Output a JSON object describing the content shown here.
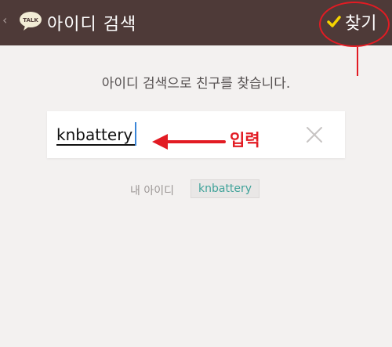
{
  "header": {
    "back_glyph": "‹",
    "logo_text": "TALK",
    "title": "아이디 검색",
    "find_label": "찾기"
  },
  "main": {
    "instruction": "아이디 검색으로 친구를 찾습니다.",
    "search_value": "knbattery",
    "annotation": "입력",
    "my_id_label": "내 아이디",
    "my_id_value": "knbattery"
  },
  "colors": {
    "topbar": "#4e3a38",
    "background": "#f3f1f0",
    "check_accent": "#f5d400",
    "annotation_red": "#e21b23",
    "my_id_text": "#41a39a"
  },
  "icons": [
    "back-arrow-icon",
    "talk-logo-icon",
    "check-icon",
    "clear-icon",
    "left-arrow-icon"
  ]
}
